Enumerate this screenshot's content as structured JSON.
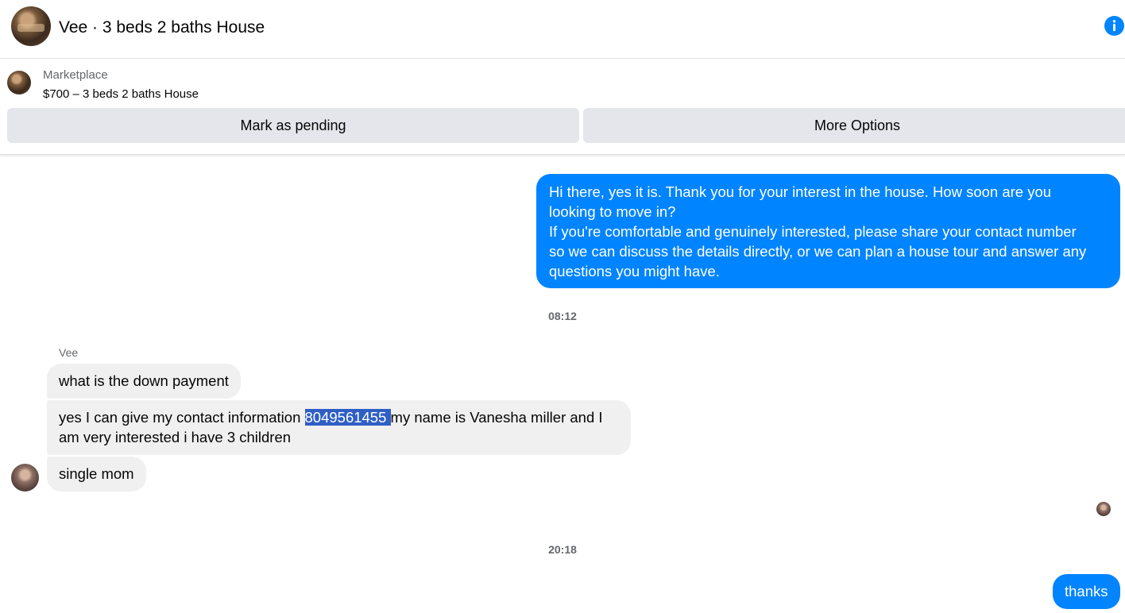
{
  "header": {
    "title": "Vee · 3 beds 2 baths House",
    "info_icon": "info-icon",
    "accent": "#0084ff"
  },
  "listing": {
    "source": "Marketplace",
    "title": "$700 – 3 beds 2 baths House",
    "buttons": {
      "pending": "Mark as pending",
      "more": "More Options"
    }
  },
  "messages": {
    "out1": {
      "line1": "Hi there, yes it is. Thank you for your interest in the house. How soon are you",
      "line2": "looking to move in?",
      "line3": "If you're comfortable and genuinely interested, please share your contact number",
      "line4": "so we can discuss the details directly, or we can plan a house tour and answer any",
      "line5": "questions you might have."
    },
    "time1": "08:12",
    "sender": "Vee",
    "in1": "what is the down payment",
    "in2": {
      "before": "yes I can give my contact information ",
      "highlighted": "8049561455 ",
      "after": "my name is Vanesha miller and I",
      "line2": "am very interested i have 3 children"
    },
    "in3": "single mom",
    "time2": "20:18",
    "out2": "thanks"
  }
}
